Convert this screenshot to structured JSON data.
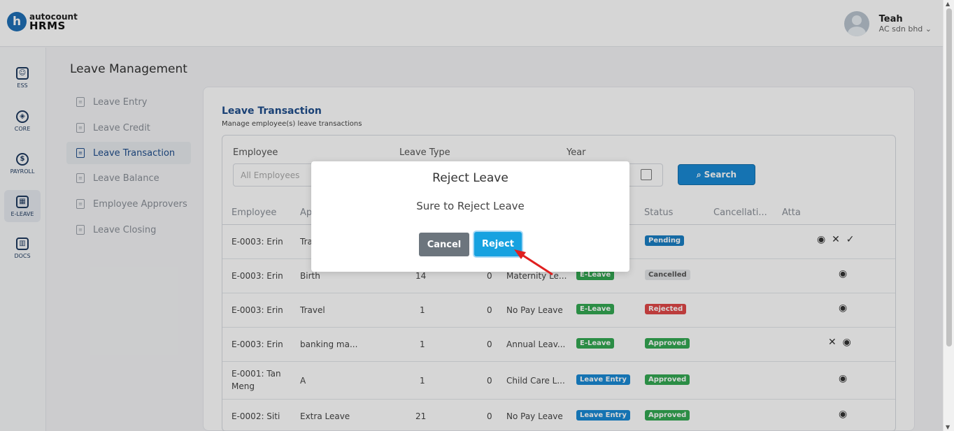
{
  "app": {
    "logo_letter": "h",
    "logo_top": "autocount",
    "logo_bottom": "HRMS"
  },
  "user": {
    "name": "Teah",
    "company": "AC sdn bhd"
  },
  "nav": [
    {
      "label": "ESS",
      "icon": "id-card-icon",
      "glyph": "☺"
    },
    {
      "label": "CORE",
      "icon": "cube-icon",
      "glyph": "◈"
    },
    {
      "label": "PAYROLL",
      "icon": "dollar-icon",
      "glyph": "$"
    },
    {
      "label": "E-LEAVE",
      "icon": "calendar-icon",
      "glyph": "▦"
    },
    {
      "label": "DOCS",
      "icon": "document-chart-icon",
      "glyph": "▥"
    }
  ],
  "page_title": "Leave Management",
  "submenu": [
    {
      "label": "Leave Entry"
    },
    {
      "label": "Leave Credit"
    },
    {
      "label": "Leave Transaction"
    },
    {
      "label": "Leave Balance"
    },
    {
      "label": "Employee Approvers"
    },
    {
      "label": "Leave Closing"
    }
  ],
  "panel": {
    "title": "Leave Transaction",
    "subtitle": "Manage employee(s) leave transactions"
  },
  "filters": {
    "employee_label": "Employee",
    "employee_placeholder": "All Employees",
    "leave_type_label": "Leave Type",
    "year_label": "Year",
    "search_label": "Search"
  },
  "columns": [
    "Employee",
    "Ap",
    "Status",
    "Cancellati...",
    "Atta"
  ],
  "rows": [
    {
      "employee": "E-0003: Erin",
      "reason": "Tra",
      "days": "",
      "zero": "",
      "type": "",
      "source": "",
      "status": "Pending",
      "actions": "👁  ✕  ✓"
    },
    {
      "employee": "E-0003: Erin",
      "reason": "Birth",
      "days": "14",
      "zero": "0",
      "type": "Maternity Le...",
      "source": "E-Leave",
      "status": "Cancelled",
      "actions": "👁"
    },
    {
      "employee": "E-0003: Erin",
      "reason": "Travel",
      "days": "1",
      "zero": "0",
      "type": "No Pay Leave",
      "source": "E-Leave",
      "status": "Rejected",
      "actions": "👁"
    },
    {
      "employee": "E-0003: Erin",
      "reason": "banking ma...",
      "days": "1",
      "zero": "0",
      "type": "Annual Leav...",
      "source": "E-Leave",
      "status": "Approved",
      "actions": "✕  👁"
    },
    {
      "employee": "E-0001: Tan Meng",
      "reason": "A",
      "days": "1",
      "zero": "0",
      "type": "Child Care L...",
      "source": "Leave Entry",
      "status": "Approved",
      "actions": "👁"
    },
    {
      "employee": "E-0002: Siti",
      "reason": "Extra Leave",
      "days": "21",
      "zero": "0",
      "type": "No Pay Leave",
      "source": "Leave Entry",
      "status": "Approved",
      "actions": "👁"
    }
  ],
  "modal": {
    "title": "Reject Leave",
    "message": "Sure to Reject Leave",
    "cancel": "Cancel",
    "reject": "Reject"
  },
  "colors": {
    "brand": "#1f4e8c",
    "primary": "#1a8ad4",
    "success": "#34a853",
    "danger": "#e04848",
    "annotation_arrow": "#e02020"
  }
}
